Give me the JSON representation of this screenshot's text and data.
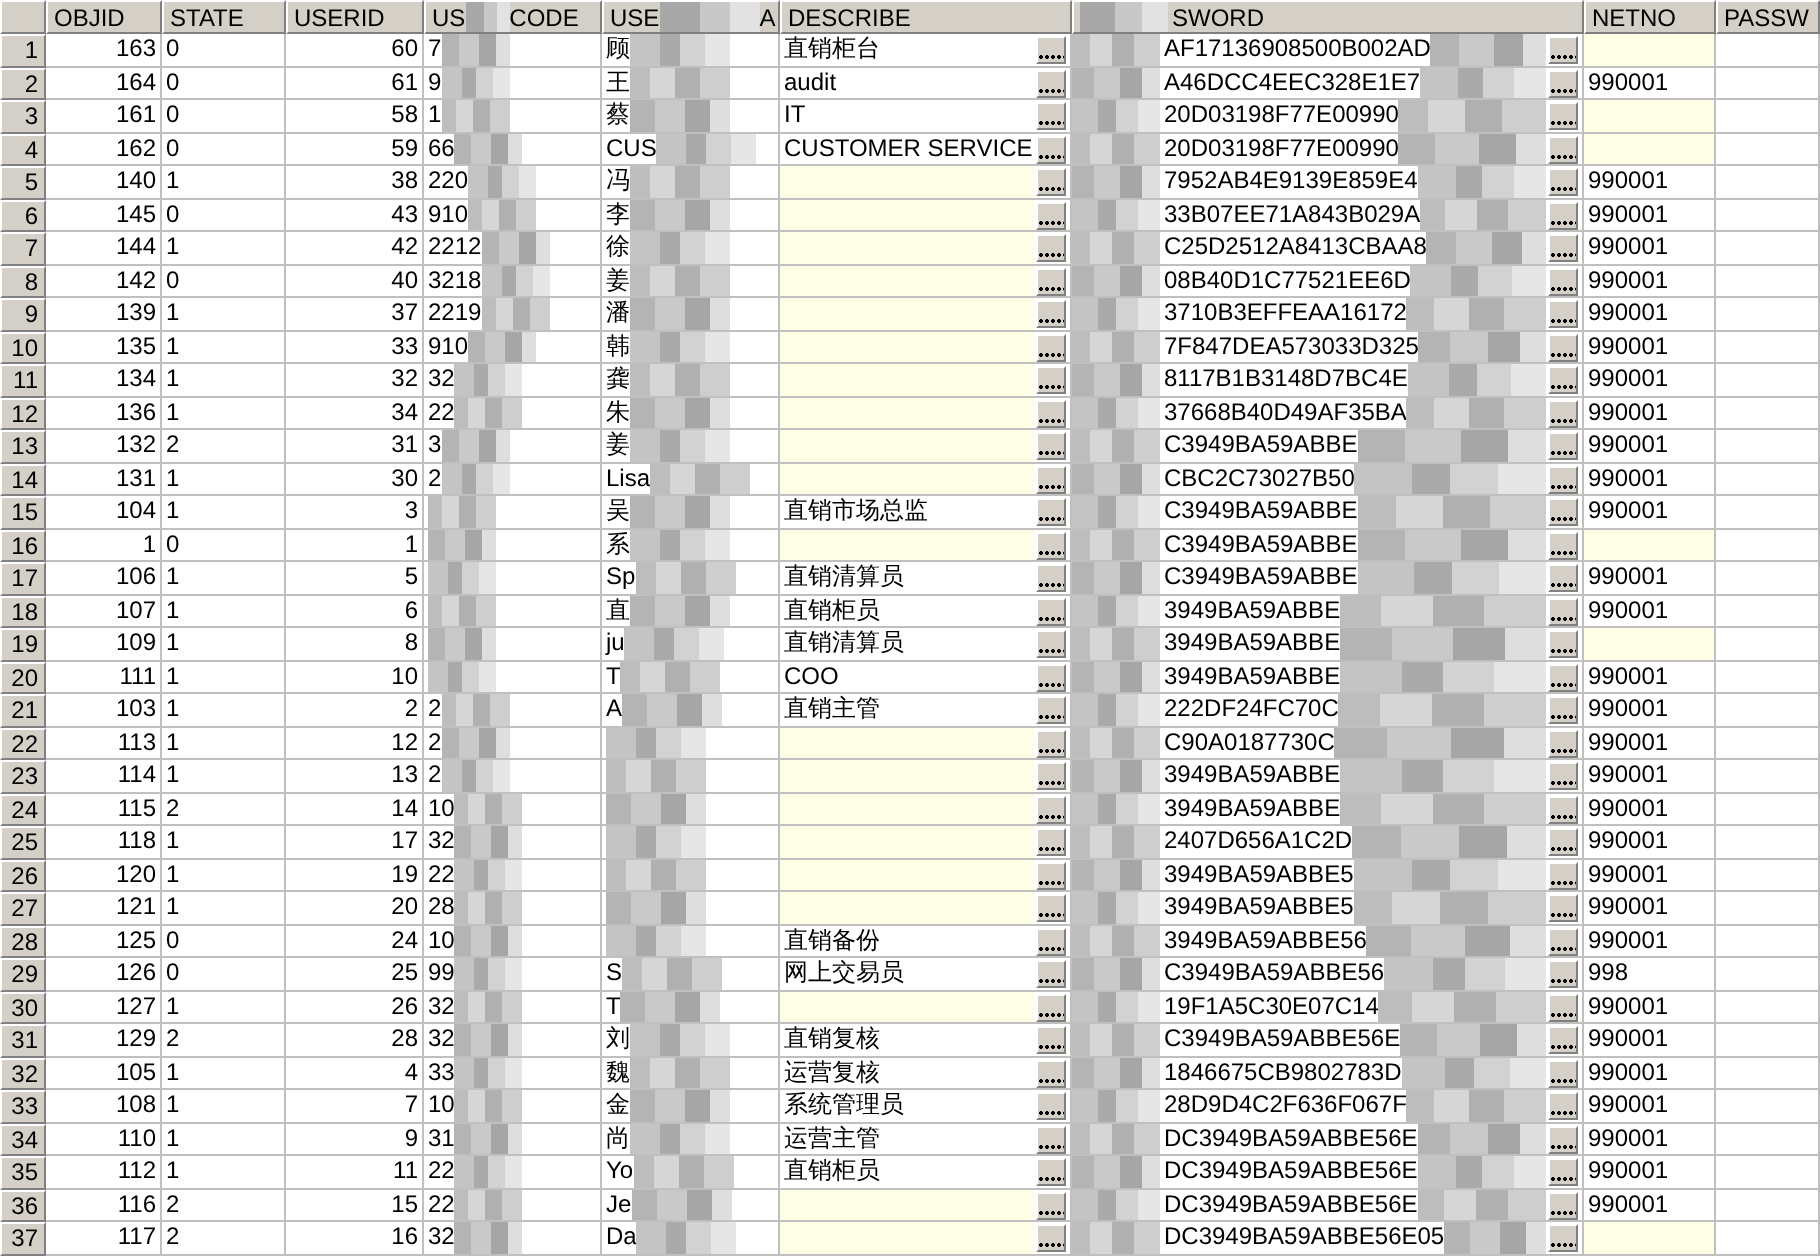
{
  "columns": [
    {
      "kind": "plain",
      "label": "OBJID"
    },
    {
      "kind": "plain",
      "label": "STATE"
    },
    {
      "kind": "plain",
      "label": "USERID"
    },
    {
      "kind": "split",
      "label": "US",
      "label_end": "CODE"
    },
    {
      "kind": "split",
      "label": "USE",
      "label_end": "A"
    },
    {
      "kind": "plain",
      "label": "DESCRIBE"
    },
    {
      "kind": "cut_start",
      "label": "SWORD"
    },
    {
      "kind": "plain",
      "label": "NETNO"
    },
    {
      "kind": "plain",
      "label": "PASSW"
    }
  ],
  "rows": [
    {
      "num": "1",
      "objid": "163",
      "state": "0",
      "userid": "60",
      "usercode": "7",
      "username": "顾",
      "describe": "直销柜台",
      "describe_null": false,
      "password": "AF17136908500B002AD",
      "netno_null": true
    },
    {
      "num": "2",
      "objid": "164",
      "state": "0",
      "userid": "61",
      "usercode": "9",
      "username": "王",
      "describe": "audit",
      "describe_null": false,
      "password": "A46DCC4EEC328E1E7",
      "netno": "990001",
      "netno_null": false
    },
    {
      "num": "3",
      "objid": "161",
      "state": "0",
      "userid": "58",
      "usercode": "1",
      "username": "蔡",
      "describe": "IT",
      "describe_null": false,
      "password": "20D03198F77E00990",
      "netno_null": true
    },
    {
      "num": "4",
      "objid": "162",
      "state": "0",
      "userid": "59",
      "usercode": "66",
      "username": "CUS",
      "describe": "CUSTOMER SERVICE",
      "describe_null": false,
      "password": "20D03198F77E00990",
      "netno_null": true
    },
    {
      "num": "5",
      "objid": "140",
      "state": "1",
      "userid": "38",
      "usercode": "220",
      "username": "冯",
      "describe_null": true,
      "password": "7952AB4E9139E859E4",
      "netno": "990001",
      "netno_null": false
    },
    {
      "num": "6",
      "objid": "145",
      "state": "0",
      "userid": "43",
      "usercode": "910",
      "username": "李",
      "describe_null": true,
      "password": "33B07EE71A843B029A",
      "netno": "990001",
      "netno_null": false
    },
    {
      "num": "7",
      "objid": "144",
      "state": "1",
      "userid": "42",
      "usercode": "2212",
      "username": "徐",
      "describe_null": true,
      "password": "C25D2512A8413CBAA8",
      "netno": "990001",
      "netno_null": false
    },
    {
      "num": "8",
      "objid": "142",
      "state": "0",
      "userid": "40",
      "usercode": "3218",
      "username": "姜",
      "describe_null": true,
      "password": "08B40D1C77521EE6D",
      "netno": "990001",
      "netno_null": false
    },
    {
      "num": "9",
      "objid": "139",
      "state": "1",
      "userid": "37",
      "usercode": "2219",
      "username": "潘",
      "describe_null": true,
      "password": "3710B3EFFEAA16172",
      "netno": "990001",
      "netno_null": false
    },
    {
      "num": "10",
      "objid": "135",
      "state": "1",
      "userid": "33",
      "usercode": "910",
      "username": "韩",
      "describe_null": true,
      "password": "7F847DEA573033D325",
      "netno": "990001",
      "netno_null": false
    },
    {
      "num": "11",
      "objid": "134",
      "state": "1",
      "userid": "32",
      "usercode": "32",
      "username": "龚",
      "describe_null": true,
      "password": "8117B1B3148D7BC4E",
      "netno": "990001",
      "netno_null": false
    },
    {
      "num": "12",
      "objid": "136",
      "state": "1",
      "userid": "34",
      "usercode": "22",
      "username": "朱",
      "describe_null": true,
      "password": "37668B40D49AF35BA",
      "netno": "990001",
      "netno_null": false
    },
    {
      "num": "13",
      "objid": "132",
      "state": "2",
      "userid": "31",
      "usercode": "3",
      "username": "姜",
      "describe_null": true,
      "password": "C3949BA59ABBE",
      "netno": "990001",
      "netno_null": false
    },
    {
      "num": "14",
      "objid": "131",
      "state": "1",
      "userid": "30",
      "usercode": "2",
      "username": "Lisa",
      "describe_null": true,
      "password": "CBC2C73027B50",
      "netno": "990001",
      "netno_null": false
    },
    {
      "num": "15",
      "objid": "104",
      "state": "1",
      "userid": "3",
      "username": "吴",
      "describe": "直销市场总监",
      "describe_null": false,
      "password": "C3949BA59ABBE",
      "netno": "990001",
      "netno_null": false
    },
    {
      "num": "16",
      "objid": "1",
      "state": "0",
      "userid": "1",
      "username": "系",
      "describe_null": true,
      "password": "C3949BA59ABBE",
      "netno_null": true
    },
    {
      "num": "17",
      "objid": "106",
      "state": "1",
      "userid": "5",
      "username": "Sp",
      "describe": "直销清算员",
      "describe_null": false,
      "password": "C3949BA59ABBE",
      "netno": "990001",
      "netno_null": false
    },
    {
      "num": "18",
      "objid": "107",
      "state": "1",
      "userid": "6",
      "username": "直",
      "describe": "直销柜员",
      "describe_null": false,
      "password": "3949BA59ABBE",
      "netno": "990001",
      "netno_null": false
    },
    {
      "num": "19",
      "objid": "109",
      "state": "1",
      "userid": "8",
      "username": "ju",
      "describe": "直销清算员",
      "describe_null": false,
      "password": "3949BA59ABBE",
      "netno_null": true
    },
    {
      "num": "20",
      "objid": "111",
      "state": "1",
      "userid": "10",
      "username": "T",
      "describe": "COO",
      "describe_null": false,
      "password": "3949BA59ABBE",
      "netno": "990001",
      "netno_null": false
    },
    {
      "num": "21",
      "objid": "103",
      "state": "1",
      "userid": "2",
      "usercode": "2",
      "username": "A",
      "describe": "直销主管",
      "describe_null": false,
      "password": "222DF24FC70C",
      "netno": "990001",
      "netno_null": false
    },
    {
      "num": "22",
      "objid": "113",
      "state": "1",
      "userid": "12",
      "usercode": "2",
      "describe_null": true,
      "password": "C90A0187730C",
      "netno": "990001",
      "netno_null": false
    },
    {
      "num": "23",
      "objid": "114",
      "state": "1",
      "userid": "13",
      "usercode": "2",
      "describe_null": true,
      "password": "3949BA59ABBE",
      "netno": "990001",
      "netno_null": false
    },
    {
      "num": "24",
      "objid": "115",
      "state": "2",
      "userid": "14",
      "usercode": "10",
      "describe_null": true,
      "password": "3949BA59ABBE",
      "netno": "990001",
      "netno_null": false
    },
    {
      "num": "25",
      "objid": "118",
      "state": "1",
      "userid": "17",
      "usercode": "32",
      "describe_null": true,
      "password": "2407D656A1C2D",
      "netno": "990001",
      "netno_null": false
    },
    {
      "num": "26",
      "objid": "120",
      "state": "1",
      "userid": "19",
      "usercode": "22",
      "describe_null": true,
      "password": "3949BA59ABBE5",
      "netno": "990001",
      "netno_null": false
    },
    {
      "num": "27",
      "objid": "121",
      "state": "1",
      "userid": "20",
      "usercode": "28",
      "describe_null": true,
      "password": "3949BA59ABBE5",
      "netno": "990001",
      "netno_null": false
    },
    {
      "num": "28",
      "objid": "125",
      "state": "0",
      "userid": "24",
      "usercode": "10",
      "describe": "直销备份",
      "describe_null": false,
      "password": "3949BA59ABBE56",
      "netno": "990001",
      "netno_null": false
    },
    {
      "num": "29",
      "objid": "126",
      "state": "0",
      "userid": "25",
      "usercode": "99",
      "username": "S",
      "describe": "网上交易员",
      "describe_null": false,
      "password": "C3949BA59ABBE56",
      "netno": "998",
      "netno_null": false
    },
    {
      "num": "30",
      "objid": "127",
      "state": "1",
      "userid": "26",
      "usercode": "32",
      "username": "T",
      "describe_null": true,
      "password": "19F1A5C30E07C14",
      "netno": "990001",
      "netno_null": false
    },
    {
      "num": "31",
      "objid": "129",
      "state": "2",
      "userid": "28",
      "usercode": "32",
      "username": "刘",
      "describe": "直销复核",
      "describe_null": false,
      "password": "C3949BA59ABBE56E",
      "netno": "990001",
      "netno_null": false
    },
    {
      "num": "32",
      "objid": "105",
      "state": "1",
      "userid": "4",
      "usercode": "33",
      "username": "魏",
      "describe": "运营复核",
      "describe_null": false,
      "password": "1846675CB9802783D",
      "netno": "990001",
      "netno_null": false
    },
    {
      "num": "33",
      "objid": "108",
      "state": "1",
      "userid": "7",
      "usercode": "10",
      "username": "金",
      "describe": "系统管理员",
      "describe_null": false,
      "password": "28D9D4C2F636F067F",
      "netno": "990001",
      "netno_null": false
    },
    {
      "num": "34",
      "objid": "110",
      "state": "1",
      "userid": "9",
      "usercode": "31",
      "username": "尚",
      "describe": "运营主管",
      "describe_null": false,
      "password": "DC3949BA59ABBE56E",
      "netno": "990001",
      "netno_null": false
    },
    {
      "num": "35",
      "objid": "112",
      "state": "1",
      "userid": "11",
      "usercode": "22",
      "username": "Yo",
      "describe": "直销柜员",
      "describe_null": false,
      "password": "DC3949BA59ABBE56E",
      "netno": "990001",
      "netno_null": false
    },
    {
      "num": "36",
      "objid": "116",
      "state": "2",
      "userid": "15",
      "usercode": "22",
      "username": "Je",
      "describe_null": true,
      "password": "DC3949BA59ABBE56E",
      "netno": "990001",
      "netno_null": false
    },
    {
      "num": "37",
      "objid": "117",
      "state": "2",
      "userid": "16",
      "usercode": "32",
      "username": "Da",
      "describe_null": true,
      "password": "DC3949BA59ABBE56E05",
      "netno_null": true
    }
  ]
}
